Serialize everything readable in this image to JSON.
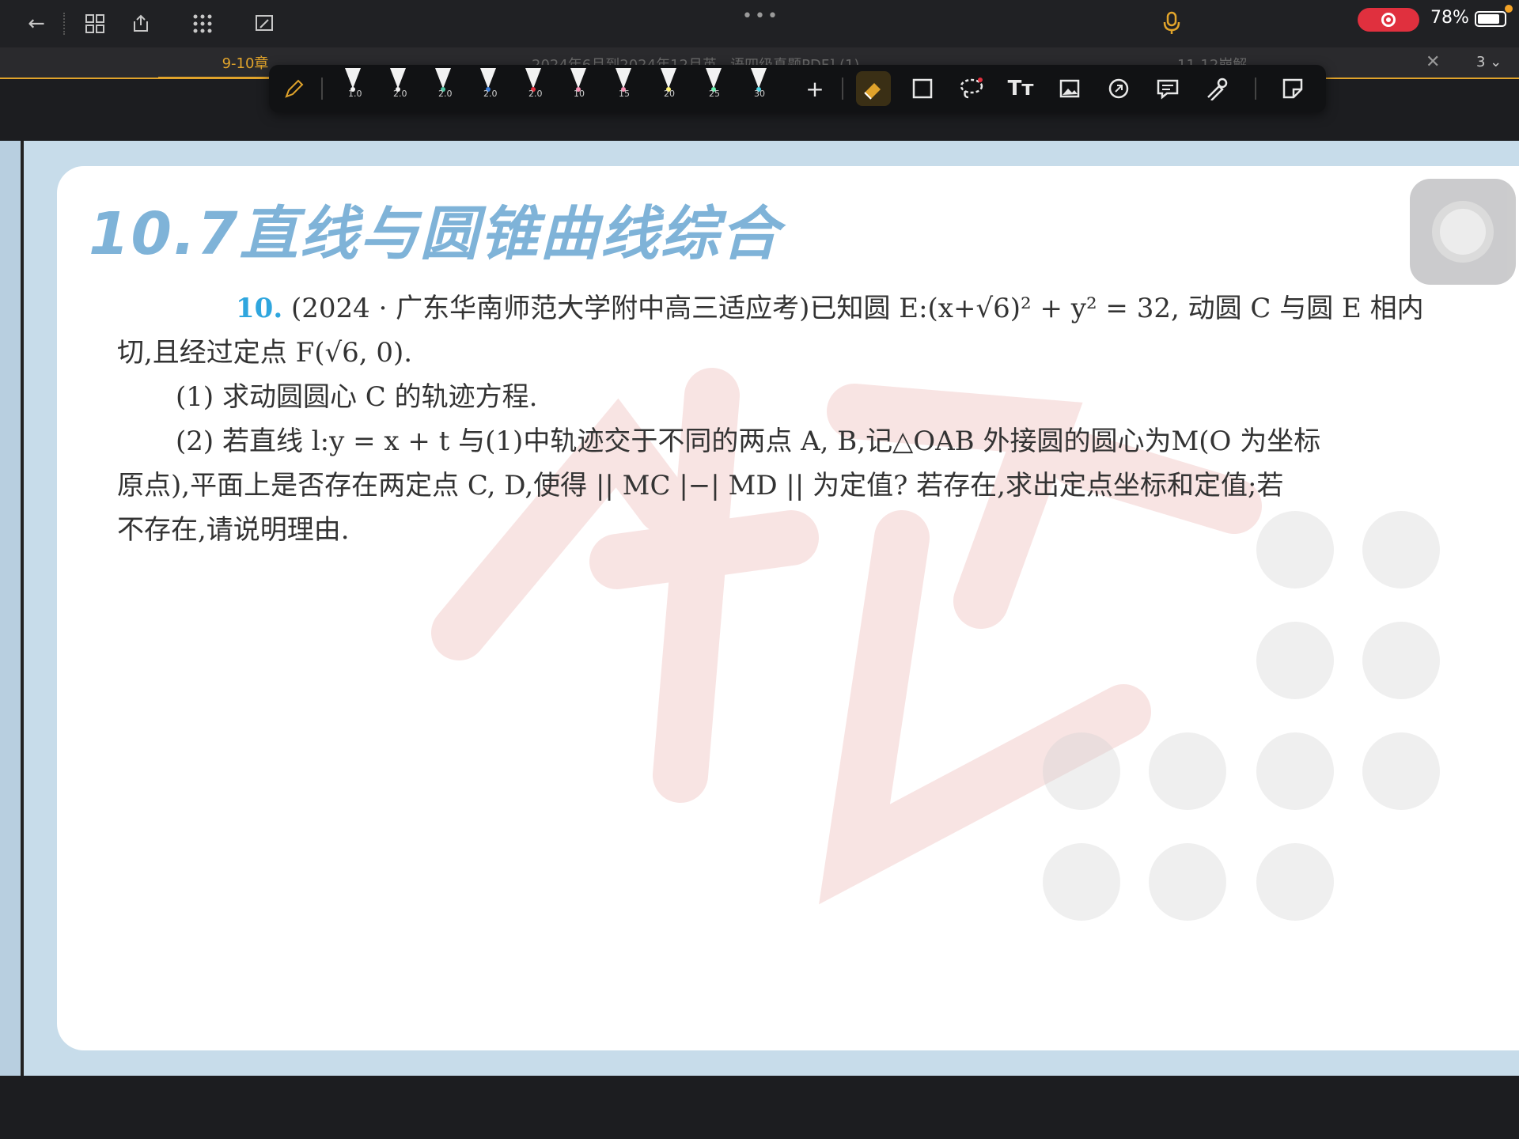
{
  "topbar": {
    "battery_percent": "78%",
    "icons": [
      "back-icon",
      "grid-icon",
      "share-icon",
      "apps-icon",
      "layout-icon",
      "more-icon",
      "mic-icon",
      "record-icon",
      "battery-icon"
    ]
  },
  "tabs": {
    "active_label": "9-10章",
    "faded_label_1": "2024年6月到2024年12月英...语四级真题PDF] (1)",
    "faded_label_2": "11-12崩解",
    "page_count": "3"
  },
  "pen_toolbar": {
    "pens": [
      {
        "size": "1.0",
        "color": "#f2f2f2"
      },
      {
        "size": "2.0",
        "color": "#f2f2f2"
      },
      {
        "size": "2.0",
        "color": "#4fc3a1"
      },
      {
        "size": "2.0",
        "color": "#3a7bd5"
      },
      {
        "size": "2.0",
        "color": "#e0303e"
      },
      {
        "size": "10",
        "color": "#f48fb1"
      },
      {
        "size": "15",
        "color": "#f48fb1"
      },
      {
        "size": "20",
        "color": "#fff176"
      },
      {
        "size": "25",
        "color": "#69f0ae"
      },
      {
        "size": "30",
        "color": "#4dd0e1"
      }
    ],
    "tools": [
      "add-icon",
      "eraser-icon",
      "shape-icon",
      "lasso-icon",
      "text-icon",
      "image-icon",
      "sticker-icon",
      "comment-icon",
      "laser-icon",
      "page-icon"
    ]
  },
  "document": {
    "title": "10.7直线与圆锥曲线综合",
    "question_number": "10.",
    "line1": "(2024 · 广东华南师范大学附中高三适应考)已知圆 E:(x+√6)² + y² = 32, 动圆 C 与圆 E 相内",
    "line2": "切,且经过定点 F(√6, 0).",
    "part1": "(1) 求动圆圆心 C 的轨迹方程.",
    "part2_line1": "(2) 若直线 l:y = x + t 与(1)中轨迹交于不同的两点 A, B,记△OAB 外接圆的圆心为M(O 为坐标",
    "part2_line2": "原点),平面上是否存在两定点 C, D,使得 || MC |−| MD || 为定值? 若存在,求出定点坐标和定值;若",
    "part2_line3": "不存在,请说明理由."
  }
}
